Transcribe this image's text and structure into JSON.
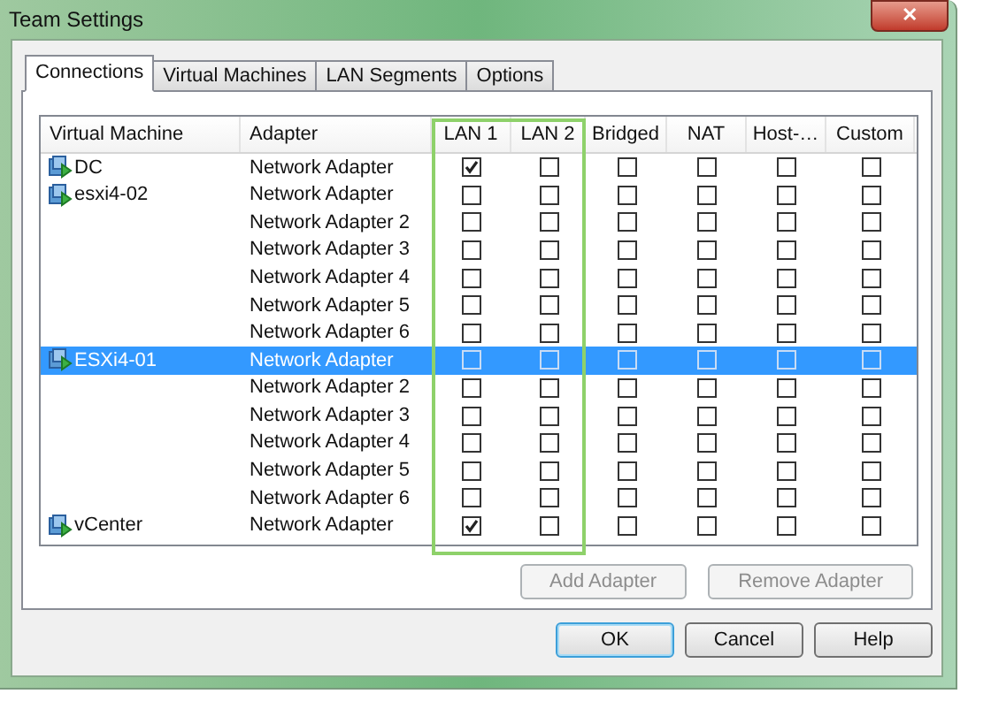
{
  "window": {
    "title": "Team Settings",
    "close": "✕"
  },
  "tabs": [
    {
      "label": "Connections",
      "selected": true
    },
    {
      "label": "Virtual Machines",
      "selected": false
    },
    {
      "label": "LAN Segments",
      "selected": false
    },
    {
      "label": "Options",
      "selected": false
    }
  ],
  "table": {
    "columns": [
      "Virtual Machine",
      "Adapter",
      "LAN 1",
      "LAN 2",
      "Bridged",
      "NAT",
      "Host-…",
      "Custom"
    ],
    "rows": [
      {
        "vm": "DC",
        "adapter": "Network Adapter",
        "selected": false,
        "checks": [
          true,
          false,
          false,
          false,
          false,
          false
        ]
      },
      {
        "vm": "esxi4-02",
        "adapter": "Network Adapter",
        "selected": false,
        "checks": [
          false,
          false,
          false,
          false,
          false,
          false
        ]
      },
      {
        "adapter": "Network Adapter 2",
        "selected": false,
        "checks": [
          false,
          false,
          false,
          false,
          false,
          false
        ]
      },
      {
        "adapter": "Network Adapter 3",
        "selected": false,
        "checks": [
          false,
          false,
          false,
          false,
          false,
          false
        ]
      },
      {
        "adapter": "Network Adapter 4",
        "selected": false,
        "checks": [
          false,
          false,
          false,
          false,
          false,
          false
        ]
      },
      {
        "adapter": "Network Adapter 5",
        "selected": false,
        "checks": [
          false,
          false,
          false,
          false,
          false,
          false
        ]
      },
      {
        "adapter": "Network Adapter 6",
        "selected": false,
        "checks": [
          false,
          false,
          false,
          false,
          false,
          false
        ]
      },
      {
        "vm": "ESXi4-01",
        "adapter": "Network Adapter",
        "selected": true,
        "checks": [
          false,
          false,
          false,
          false,
          false,
          false
        ]
      },
      {
        "adapter": "Network Adapter 2",
        "selected": false,
        "checks": [
          false,
          false,
          false,
          false,
          false,
          false
        ]
      },
      {
        "adapter": "Network Adapter 3",
        "selected": false,
        "checks": [
          false,
          false,
          false,
          false,
          false,
          false
        ]
      },
      {
        "adapter": "Network Adapter 4",
        "selected": false,
        "checks": [
          false,
          false,
          false,
          false,
          false,
          false
        ]
      },
      {
        "adapter": "Network Adapter 5",
        "selected": false,
        "checks": [
          false,
          false,
          false,
          false,
          false,
          false
        ]
      },
      {
        "adapter": "Network Adapter 6",
        "selected": false,
        "checks": [
          false,
          false,
          false,
          false,
          false,
          false
        ]
      },
      {
        "vm": "vCenter",
        "adapter": "Network Adapter",
        "selected": false,
        "checks": [
          true,
          false,
          false,
          false,
          false,
          false
        ]
      }
    ]
  },
  "adapter_buttons": [
    {
      "label": "Add Adapter",
      "disabled": true
    },
    {
      "label": "Remove Adapter",
      "disabled": true
    }
  ],
  "dialog_buttons": [
    {
      "label": "OK",
      "default": true
    },
    {
      "label": "Cancel",
      "default": false
    },
    {
      "label": "Help",
      "default": false
    }
  ]
}
